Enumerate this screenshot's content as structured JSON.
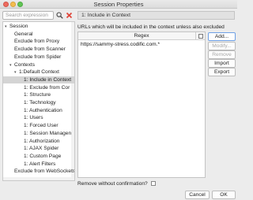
{
  "window": {
    "title": "Session Properties"
  },
  "search": {
    "placeholder": "Search expression"
  },
  "tree": {
    "items": [
      {
        "label": "Session",
        "caret": "▾",
        "level": 0
      },
      {
        "label": "General",
        "caret": "",
        "level": 1
      },
      {
        "label": "Exclude from Proxy",
        "caret": "",
        "level": 1
      },
      {
        "label": "Exclude from Scanner",
        "caret": "",
        "level": 1
      },
      {
        "label": "Exclude from Spider",
        "caret": "",
        "level": 1
      },
      {
        "label": "Contexts",
        "caret": "▾",
        "level": 1
      },
      {
        "label": "1:Default Context",
        "caret": "▾",
        "level": 2
      },
      {
        "label": "1: Include in Context",
        "caret": "",
        "level": 3,
        "selected": true
      },
      {
        "label": "1: Exclude from Cor",
        "caret": "",
        "level": 3
      },
      {
        "label": "1: Structure",
        "caret": "",
        "level": 3
      },
      {
        "label": "1: Technology",
        "caret": "",
        "level": 3
      },
      {
        "label": "1: Authentication",
        "caret": "",
        "level": 3
      },
      {
        "label": "1: Users",
        "caret": "",
        "level": 3
      },
      {
        "label": "1: Forced User",
        "caret": "",
        "level": 3
      },
      {
        "label": "1: Session Managen",
        "caret": "",
        "level": 3
      },
      {
        "label": "1: Authorization",
        "caret": "",
        "level": 3
      },
      {
        "label": "1: AJAX Spider",
        "caret": "",
        "level": 3
      },
      {
        "label": "1: Custom Page",
        "caret": "",
        "level": 3
      },
      {
        "label": "1: Alert Filters",
        "caret": "",
        "level": 3
      },
      {
        "label": "Exclude from WebSockets",
        "caret": "",
        "level": 1
      }
    ]
  },
  "panel": {
    "header": "1: Include in Context",
    "description": "URLs which will be included in the context unless also excluded",
    "column_header": "Regex",
    "rows": [
      "https://sammy-stress.codific.com.*"
    ]
  },
  "buttons": {
    "add": "Add...",
    "modify": "Modify...",
    "remove": "Remove",
    "import": "Import",
    "export": "Export",
    "cancel": "Cancel",
    "ok": "OK"
  },
  "remove_confirm": {
    "label": "Remove without confirmation?",
    "checked": false
  },
  "colors": {
    "selection": "#d4d4d4",
    "clear_icon": "#e0463a",
    "focus_border": "#6ea0e6"
  }
}
